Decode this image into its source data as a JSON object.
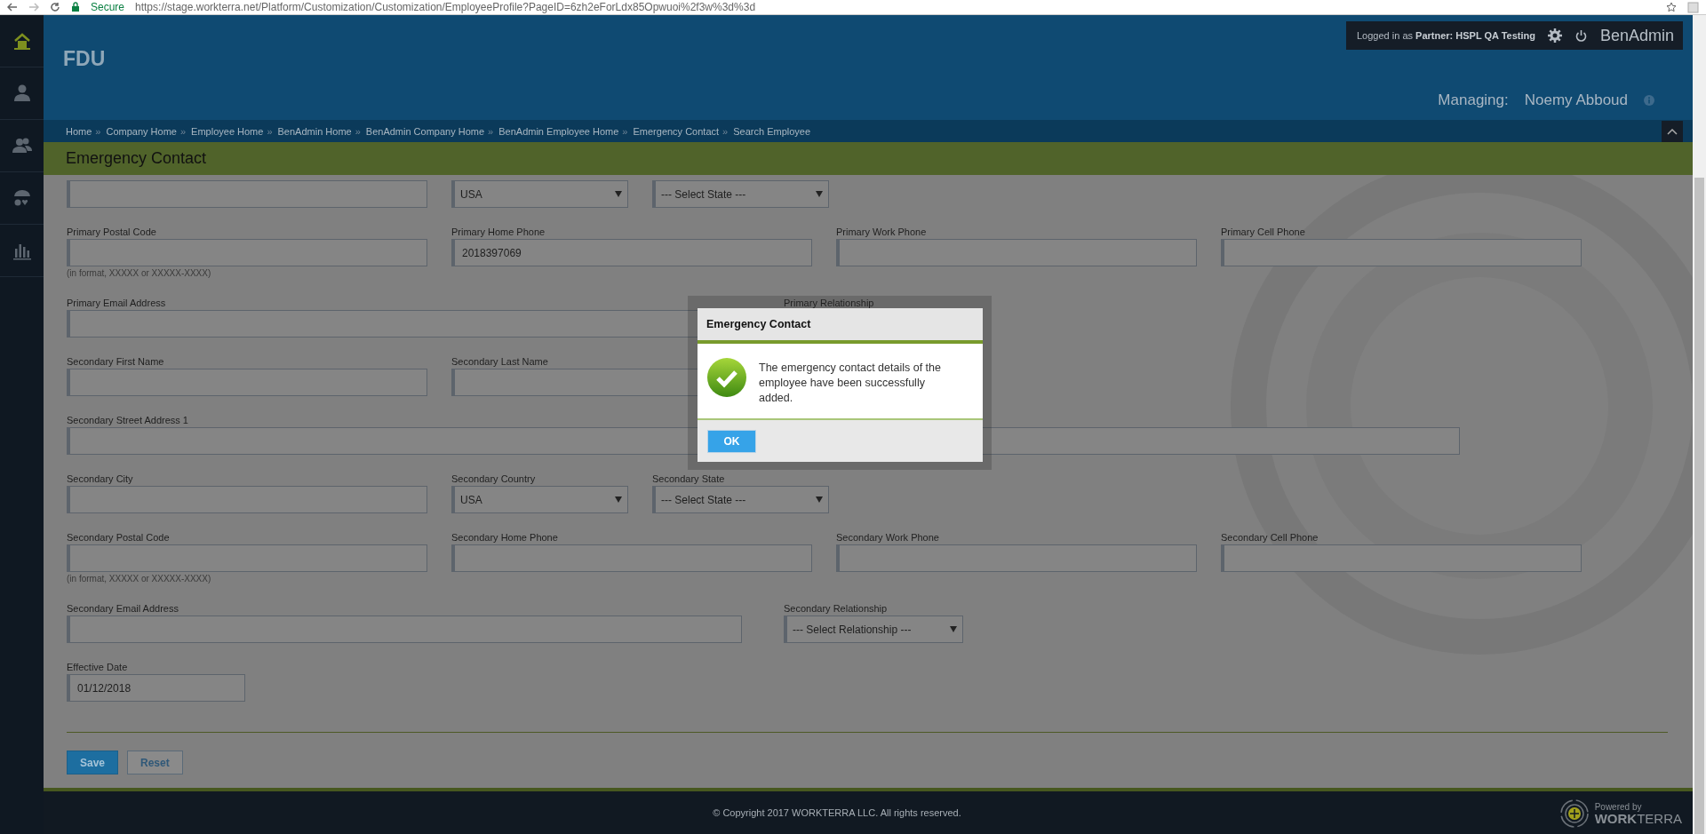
{
  "browser": {
    "security": "Secure",
    "url": "https://stage.workterra.net/Platform/Customization/Customization/EmployeeProfile?PageID=6zh2eForLdx85Opwuoi%2f3w%3d%3d"
  },
  "sidebar": {
    "items": [
      {
        "selected": true
      },
      {
        "selected": false
      },
      {
        "selected": false
      },
      {
        "selected": false
      },
      {
        "selected": false
      }
    ]
  },
  "header": {
    "org": "FDU",
    "login": "Logged in as **Partner:  HSPL QA Testing**",
    "user": "BenAdmin",
    "managing_label": "Managing:",
    "managing_name": "Noemy Abboud"
  },
  "breadcrumb": [
    {
      "label": "Home",
      "separator": "»"
    },
    {
      "label": "Company Home",
      "separator": "»"
    },
    {
      "label": "Employee Home",
      "separator": "»"
    },
    {
      "label": "BenAdmin Home",
      "separator": "»"
    },
    {
      "label": "BenAdmin Company Home",
      "separator": "»"
    },
    {
      "label": "BenAdmin Employee Home",
      "separator": "»"
    },
    {
      "label": "Emergency Contact",
      "separator": "»"
    },
    {
      "label": "Search Employee"
    }
  ],
  "page_title": "Emergency Contact",
  "form": {
    "rows": [
      [
        {
          "kind": "text"
        },
        {
          "kind": "halfselect",
          "value": "USA"
        },
        {
          "kind": "halfselect",
          "value": "--- Select State ---"
        }
      ],
      [
        {
          "kind": "text",
          "label": "Primary Postal Code",
          "hint": "(in format, XXXXX or XXXXX-XXXX)"
        },
        {
          "kind": "text",
          "label": "Primary Home Phone",
          "value": "2018397069"
        },
        {
          "kind": "text",
          "label": "Primary Work Phone"
        },
        {
          "kind": "text",
          "label": "Primary Cell Phone"
        }
      ],
      [
        {
          "kind": "longtext",
          "label": "Primary Email Address"
        },
        {
          "kind": "select",
          "label": "Primary Relationship"
        }
      ],
      [
        {
          "kind": "text",
          "label": "Secondary First Name"
        },
        {
          "kind": "text",
          "label": "Secondary Last Name"
        }
      ],
      [
        {
          "kind": "fulltext",
          "label": "Secondary Street Address 1"
        }
      ],
      [
        {
          "kind": "text",
          "label": "Secondary City"
        },
        {
          "kind": "halfselect",
          "label": "Secondary Country",
          "value": "USA"
        },
        {
          "kind": "halfselect",
          "label": "Secondary State",
          "value": "--- Select State ---"
        }
      ],
      [
        {
          "kind": "text",
          "label": "Secondary Postal Code",
          "hint": "(in format, XXXXX or XXXXX-XXXX)"
        },
        {
          "kind": "text",
          "label": "Secondary Home Phone"
        },
        {
          "kind": "text",
          "label": "Secondary Work Phone"
        },
        {
          "kind": "text",
          "label": "Secondary Cell Phone"
        }
      ],
      [
        {
          "kind": "longtext",
          "label": "Secondary Email Address"
        },
        {
          "kind": "select",
          "label": "Secondary Relationship",
          "value": "--- Select Relationship ---"
        }
      ],
      [
        {
          "kind": "shorttext",
          "label": "Effective Date",
          "value": "01/12/2018"
        }
      ]
    ],
    "buttons": [
      {
        "label": "Save",
        "kind": "primary"
      },
      {
        "label": "Reset",
        "kind": "secondary"
      }
    ]
  },
  "dialog": {
    "title": "Emergency Contact",
    "message": "The emergency contact details of the employee have been successfully added.",
    "button": "OK"
  },
  "footer": {
    "copyright": "© Copyright 2017 WORKTERRA LLC. All rights reserved.",
    "powered_by": "Powered by",
    "brand": "**WORK**TERRA"
  }
}
